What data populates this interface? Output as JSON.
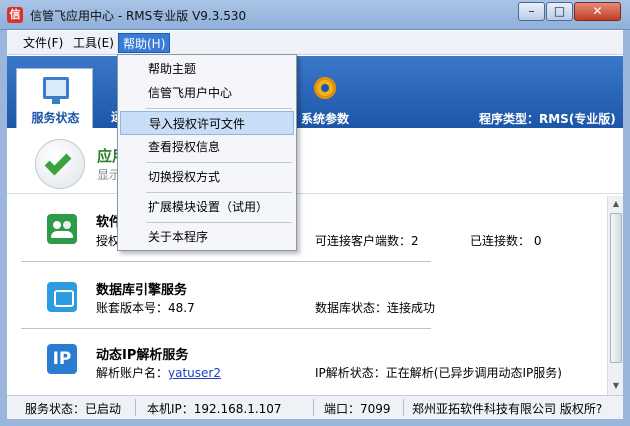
{
  "window": {
    "title": "信管飞应用中心 - RMS专业版 V9.3.530",
    "logo": "信",
    "min_glyph": "–",
    "max_glyph": "□",
    "close_glyph": "✕"
  },
  "menubar": {
    "file": "文件(F)",
    "tools": "工具(E)",
    "help": "帮助(H)"
  },
  "help_menu": {
    "items": [
      "帮助主题",
      "信管飞用户中心",
      "导入授权许可文件",
      "查看授权信息",
      "切换授权方式",
      "扩展模块设置（试用）",
      "关于本程序"
    ],
    "highlighted": "导入授权许可文件"
  },
  "header": {
    "tab_service": "服务状态",
    "tab_partial": "运",
    "tab_system": "系统参数",
    "program_type": "程序类型：RMS(专业版)"
  },
  "banner": {
    "title": "应用",
    "subtitle": "显示"
  },
  "services": [
    {
      "name": "软件",
      "line": "授权",
      "mid": "可连接客户端数：2",
      "right": "已连接数：  0"
    },
    {
      "name": "数据库引擎服务",
      "line": "账套版本号：48.7",
      "mid": "数据库状态：连接成功"
    },
    {
      "name": "动态IP解析服务",
      "line_label": "解析账户名：",
      "line_link": "yatuser2",
      "mid": "IP解析状态：正在解析(已异步调用动态IP服务)",
      "icon_text": "IP"
    }
  ],
  "statusbar": {
    "service": "服务状态：已启动",
    "ip": "本机IP：192.168.1.107",
    "port": "端口：7099",
    "company": "郑州亚拓软件科技有限公司  版权所?"
  },
  "colors": {
    "header_blue": "#1c56a8",
    "menu_highlight": "#3a7bd5",
    "success_green": "#3aa23a"
  }
}
